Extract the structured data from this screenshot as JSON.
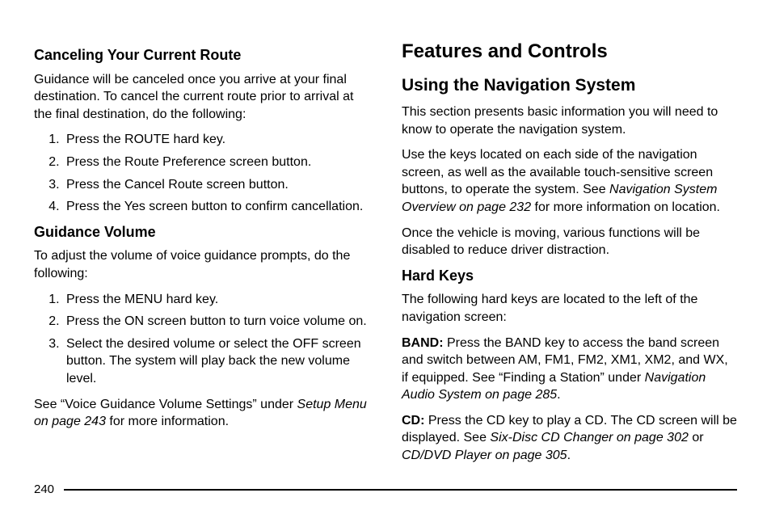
{
  "left": {
    "s1": {
      "heading": "Canceling Your Current Route",
      "intro": "Guidance will be canceled once you arrive at your final destination. To cancel the current route prior to arrival at the final destination, do the following:",
      "steps": [
        "Press the ROUTE hard key.",
        "Press the Route Preference screen button.",
        "Press the Cancel Route screen button.",
        "Press the Yes screen button to confirm cancellation."
      ]
    },
    "s2": {
      "heading": "Guidance Volume",
      "intro": "To adjust the volume of voice guidance prompts, do the following:",
      "steps": [
        "Press the MENU hard key.",
        "Press the ON screen button to turn voice volume on.",
        "Select the desired volume or select the OFF screen button. The system will play back the new volume level."
      ],
      "note_a": "See “Voice Guidance Volume Settings” under ",
      "note_ref": "Setup Menu on page 243",
      "note_b": " for more information."
    }
  },
  "right": {
    "title": "Features and Controls",
    "s1": {
      "heading": "Using the Navigation System",
      "p1": "This section presents basic information you will need to know to operate the navigation system.",
      "p2a": "Use the keys located on each side of the navigation screen, as well as the available touch-sensitive screen buttons, to operate the system. See ",
      "p2ref": "Navigation System Overview on page 232",
      "p2b": " for more information on location.",
      "p3": "Once the vehicle is moving, various functions will be disabled to reduce driver distraction."
    },
    "s2": {
      "heading": "Hard Keys",
      "intro": "The following hard keys are located to the left of the navigation screen:",
      "band": {
        "label": "BAND:",
        "text_a": "  Press the BAND key to access the band screen and switch between AM, FM1, FM2, XM1, XM2, and WX, if equipped. See “Finding a Station” under ",
        "ref": "Navigation Audio System on page 285",
        "text_b": "."
      },
      "cd": {
        "label": "CD:",
        "text_a": "  Press the CD key to play a CD. The CD screen will be displayed. See ",
        "ref1": "Six-Disc CD Changer on page 302",
        "mid": " or ",
        "ref2": "CD/DVD Player on page 305",
        "text_b": "."
      }
    }
  },
  "page_number": "240"
}
